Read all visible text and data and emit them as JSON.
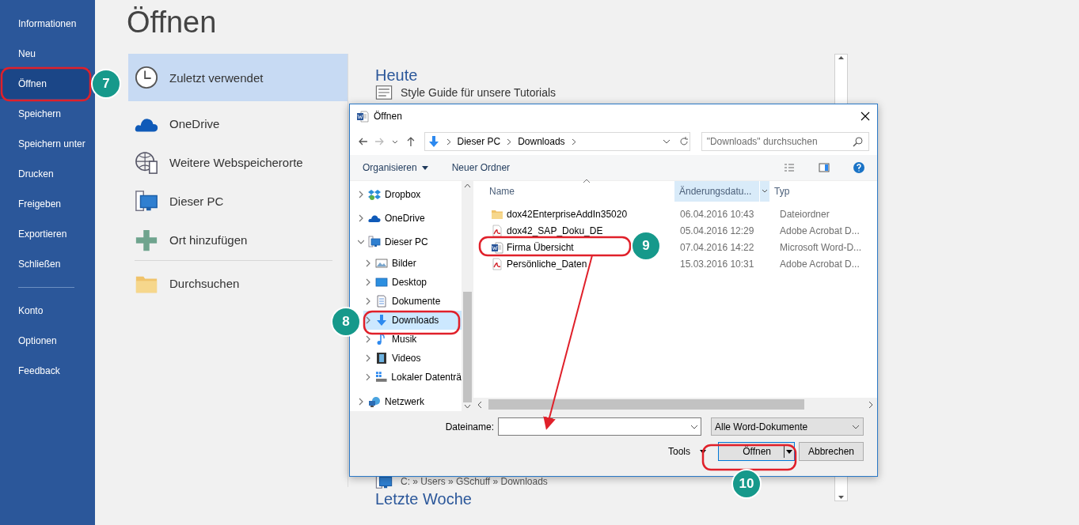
{
  "sidebar": {
    "sections": [
      {
        "items": [
          {
            "label": "Informationen",
            "selected": false
          },
          {
            "label": "Neu",
            "selected": false
          },
          {
            "label": "Öffnen",
            "selected": true
          },
          {
            "label": "Speichern",
            "selected": false
          },
          {
            "label": "Speichern unter",
            "selected": false
          },
          {
            "label": "Drucken",
            "selected": false
          },
          {
            "label": "Freigeben",
            "selected": false
          },
          {
            "label": "Exportieren",
            "selected": false
          },
          {
            "label": "Schließen",
            "selected": false
          }
        ]
      },
      {
        "items": [
          {
            "label": "Konto",
            "selected": false
          },
          {
            "label": "Optionen",
            "selected": false
          },
          {
            "label": "Feedback",
            "selected": false
          }
        ]
      }
    ]
  },
  "page_title": "Öffnen",
  "places": {
    "sections": [
      {
        "items": [
          {
            "label": "Zuletzt verwendet",
            "kind": "clock",
            "selected": true
          },
          {
            "label": "OneDrive",
            "kind": "cloud",
            "selected": false
          },
          {
            "label": "Weitere Webspeicherorte",
            "kind": "globe",
            "selected": false
          },
          {
            "label": "Dieser PC",
            "kind": "pc",
            "selected": false
          },
          {
            "label": "Ort hinzufügen",
            "kind": "plus",
            "selected": false
          }
        ]
      },
      {
        "items": [
          {
            "label": "Durchsuchen",
            "kind": "folder",
            "selected": false
          }
        ]
      }
    ]
  },
  "recent": {
    "groups": [
      {
        "heading": "Heute",
        "items": [
          {
            "kind": "name",
            "text": "Style Guide für unsere Tutorials"
          },
          {
            "kind": "path",
            "text": "C: » Users » GSchuff » Downloads"
          }
        ]
      },
      {
        "heading": "Letzte Woche"
      }
    ]
  },
  "dialog": {
    "title": "Öffnen",
    "breadcrumb": [
      "Dieser PC",
      "Downloads"
    ],
    "search_placeholder": "\"Downloads\" durchsuchen",
    "toolbar": [
      "Organisieren",
      "Neuer Ordner"
    ],
    "tree": [
      {
        "label": "Dropbox",
        "kind": "dropbox",
        "expanded": false,
        "selected": false
      },
      {
        "label": "OneDrive",
        "kind": "cloud",
        "expanded": false,
        "selected": false
      },
      {
        "label": "Dieser PC",
        "kind": "pc",
        "expanded": true,
        "selected": false,
        "children": [
          {
            "label": "Bilder",
            "kind": "pictures",
            "expanded": false,
            "selected": false
          },
          {
            "label": "Desktop",
            "kind": "desktop",
            "expanded": false,
            "selected": false
          },
          {
            "label": "Dokumente",
            "kind": "documents",
            "expanded": false,
            "selected": false
          },
          {
            "label": "Downloads",
            "kind": "downloads",
            "expanded": false,
            "selected": true
          },
          {
            "label": "Musik",
            "kind": "music",
            "expanded": false,
            "selected": false
          },
          {
            "label": "Videos",
            "kind": "videos",
            "expanded": false,
            "selected": false
          },
          {
            "label": "Lokaler Datenträ",
            "kind": "drive",
            "expanded": false,
            "selected": false
          }
        ]
      },
      {
        "label": "Netzwerk",
        "kind": "network",
        "expanded": false,
        "selected": false
      }
    ],
    "columns": [
      {
        "label": "Name",
        "sorted": true,
        "highlighted": false
      },
      {
        "label": "Änderungsdatu...",
        "sorted": false,
        "highlighted": true
      },
      {
        "label": "Typ",
        "sorted": false,
        "highlighted": false
      }
    ],
    "files": [
      {
        "name": "dox42EnterpriseAddIn35020",
        "date": "06.04.2016 10:43",
        "type": "Dateiordner",
        "kind": "folder"
      },
      {
        "name": "dox42_SAP_Doku_DE",
        "date": "05.04.2016 12:29",
        "type": "Adobe Acrobat D...",
        "kind": "pdf"
      },
      {
        "name": "Firma Übersicht",
        "date": "07.04.2016 14:22",
        "type": "Microsoft Word-D...",
        "kind": "word"
      },
      {
        "name": "Persönliche_Daten",
        "date": "15.03.2016 10:31",
        "type": "Adobe Acrobat D...",
        "kind": "pdf"
      }
    ],
    "filename_label": "Dateiname:",
    "filter": "Alle Word-Dokumente",
    "tools": "Tools",
    "buttons": [
      {
        "label": "Öffnen",
        "kind": "split",
        "focused": true
      },
      {
        "label": "Abbrechen",
        "kind": "plain",
        "focused": false
      }
    ]
  },
  "callouts": [
    {
      "number": "7"
    },
    {
      "number": "8"
    },
    {
      "number": "9"
    },
    {
      "number": "10"
    }
  ]
}
